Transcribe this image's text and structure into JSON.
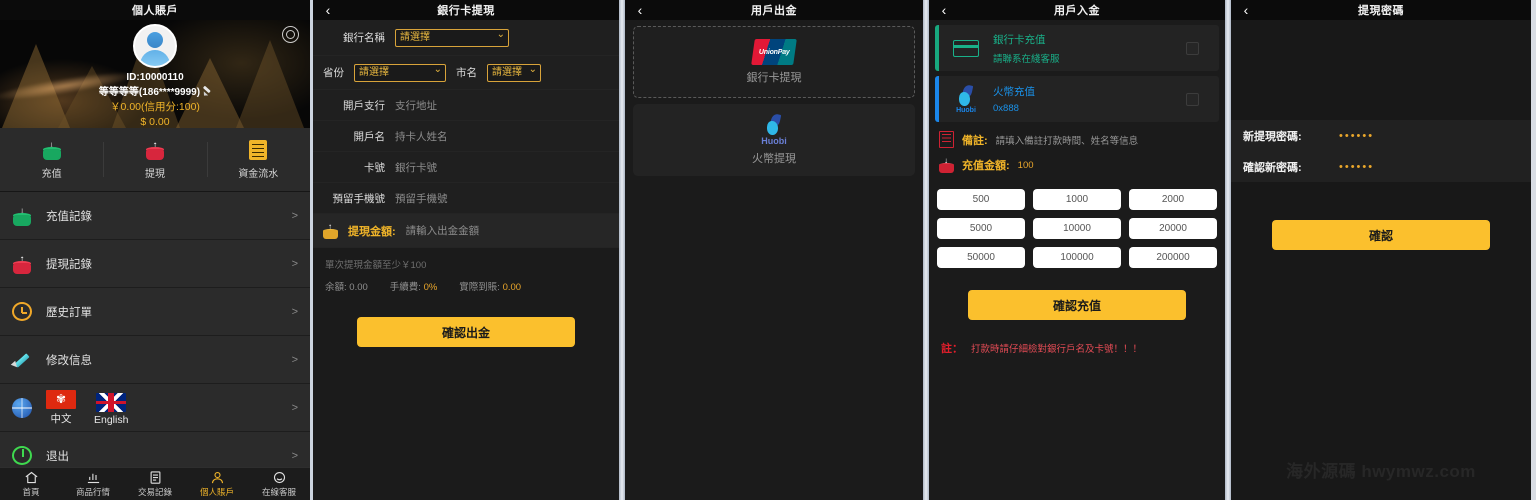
{
  "panels": {
    "profile": {
      "title": "個人賬戶",
      "gear_icon": "gear-icon",
      "id_text": "ID:10000110",
      "name_text": "等等等等(186****9999)",
      "balance_cny": "￥0.00(信用分:100)",
      "balance_usd": "$ 0.00",
      "quick_actions": [
        {
          "label": "充值",
          "icon": "deposit-coin-icon"
        },
        {
          "label": "提現",
          "icon": "withdraw-coin-icon"
        },
        {
          "label": "資金流水",
          "icon": "ledger-icon"
        }
      ],
      "menu": [
        {
          "label": "充值記錄",
          "icon": "deposit-record-icon",
          "chevron": ">"
        },
        {
          "label": "提現記錄",
          "icon": "withdraw-record-icon",
          "chevron": ">"
        },
        {
          "label": "歷史訂單",
          "icon": "clock-icon",
          "chevron": ">"
        },
        {
          "label": "修改信息",
          "icon": "pencil-icon",
          "chevron": ">"
        },
        {
          "label": "",
          "icon": "globe-icon",
          "chevron": ">",
          "languages": [
            {
              "name": "中文",
              "flag": "hk-flag-icon"
            },
            {
              "name": "English",
              "flag": "uk-flag-icon"
            }
          ]
        },
        {
          "label": "退出",
          "icon": "power-icon",
          "chevron": ">"
        }
      ],
      "tabbar": [
        {
          "label": "首頁",
          "icon": "home-icon",
          "active": false
        },
        {
          "label": "商品行情",
          "icon": "chart-icon",
          "active": false
        },
        {
          "label": "交易記錄",
          "icon": "list-icon",
          "active": false
        },
        {
          "label": "個人賬戶",
          "icon": "user-icon",
          "active": true
        },
        {
          "label": "在線客服",
          "icon": "headset-icon",
          "active": false
        }
      ]
    },
    "bank_withdraw": {
      "title": "銀行卡提現",
      "back_icon": "chevron-left-icon",
      "rows": {
        "bank_name_label": "銀行名稱",
        "bank_name_value": "請選擇",
        "province_label": "省份",
        "province_value": "請選擇",
        "city_label": "市名",
        "city_value": "請選擇",
        "branch_label": "開戶支行",
        "branch_placeholder": "支行地址",
        "holder_label": "開戶名",
        "holder_placeholder": "持卡人姓名",
        "card_label": "卡號",
        "card_placeholder": "銀行卡號",
        "phone_label": "預留手機號",
        "phone_placeholder": "預留手機號",
        "amount_label": "提現金額:",
        "amount_placeholder": "請輸入出金金額"
      },
      "hint": "單次提現金額至少￥100",
      "stats": [
        {
          "label": "余額:",
          "value": "0.00",
          "gold": false
        },
        {
          "label": "手續費:",
          "value": "0%",
          "gold": true
        },
        {
          "label": "實際到賬:",
          "value": "0.00",
          "gold": true
        }
      ],
      "submit_label": "確認出金"
    },
    "user_withdraw": {
      "title": "用戶出金",
      "back_icon": "chevron-left-icon",
      "methods": [
        {
          "name": "銀行卡提現",
          "brand": "UnionPay",
          "icon": "unionpay-icon",
          "selected": true
        },
        {
          "name": "火幣提現",
          "brand": "Huobi",
          "icon": "huobi-icon",
          "selected": false
        }
      ]
    },
    "user_deposit": {
      "title": "用戶入金",
      "back_icon": "chevron-left-icon",
      "methods": [
        {
          "title": "銀行卡充值",
          "sub": "請聯系在綫客服",
          "icon": "bank-card-icon",
          "accent": "#18a87e"
        },
        {
          "title": "火幣充值",
          "sub": "0x888",
          "icon": "huobi-icon",
          "accent": "#1a86ea"
        }
      ],
      "memo_label": "備註:",
      "memo_placeholder": "請填入備註打款時間、姓名等信息",
      "amount_label": "充值金額:",
      "amount_value": "100",
      "amount_options": [
        "500",
        "1000",
        "2000",
        "5000",
        "10000",
        "20000",
        "50000",
        "100000",
        "200000"
      ],
      "submit_label": "確認充值",
      "note_label": "註：",
      "note_text": "打款時請仔細檢對銀行戶名及卡號！！！"
    },
    "withdraw_password": {
      "title": "提現密碼",
      "back_icon": "chevron-left-icon",
      "new_label": "新提現密碼:",
      "new_value": "••••••",
      "confirm_label": "確認新密碼:",
      "confirm_value": "••••••",
      "submit_label": "確認",
      "watermark": "海外源碼  hwymwz.com"
    }
  },
  "colors": {
    "accent_gold": "#fbc02d",
    "green": "#18a860",
    "red": "#d7263d",
    "huobi_blue": "#1a86ea",
    "bg": "#1b1b1b"
  }
}
